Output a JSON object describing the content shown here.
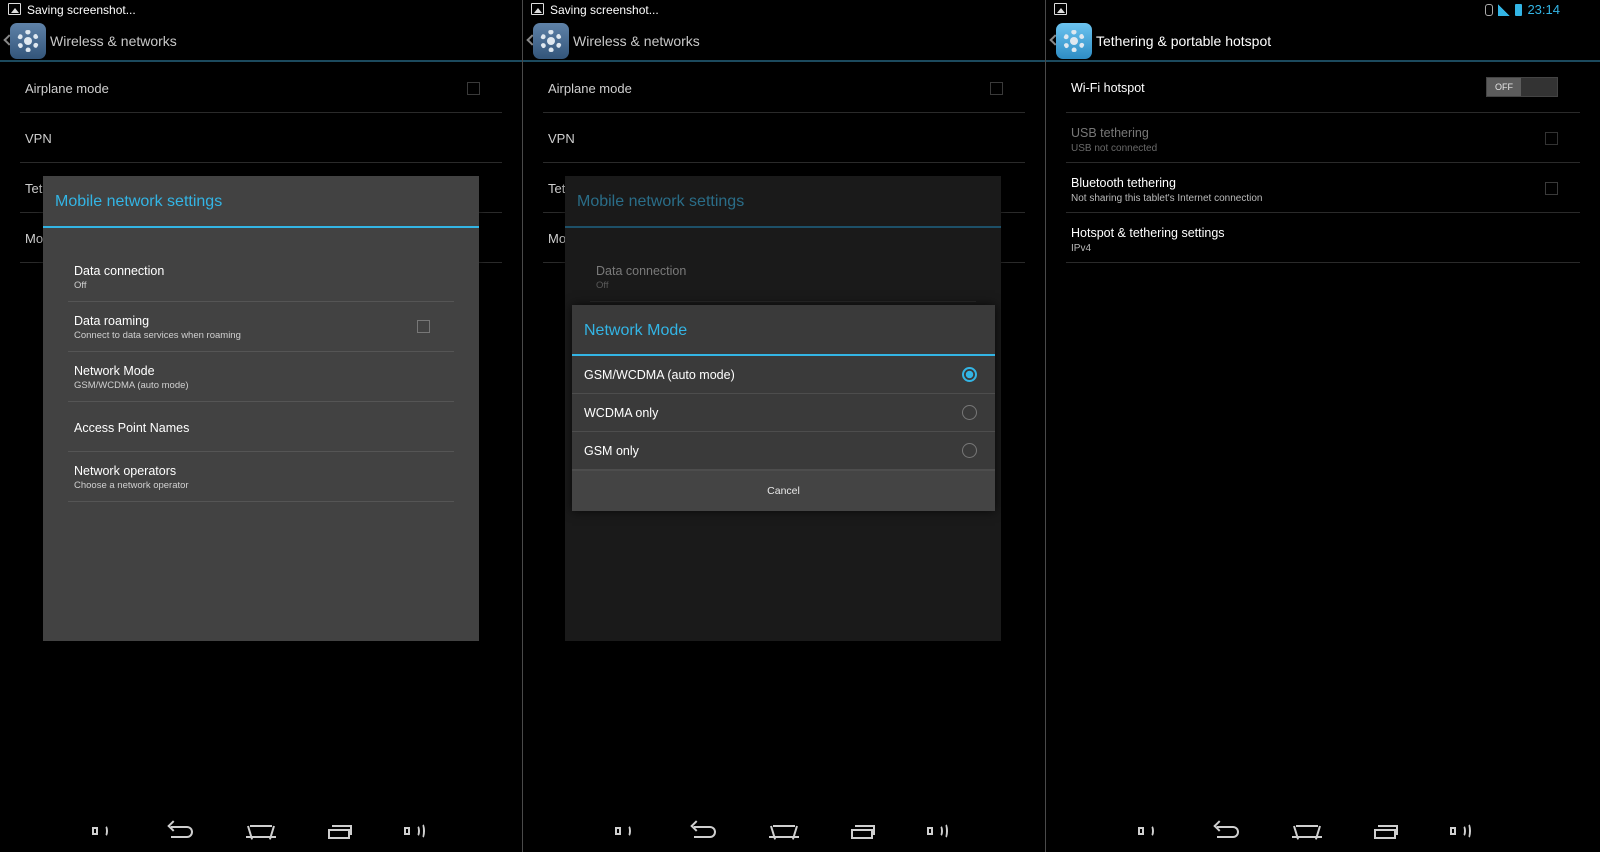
{
  "colors": {
    "accent": "#33b5e5",
    "background": "#000000",
    "dialog": "#424242"
  },
  "panels": [
    {
      "status_text": "Saving screenshot...",
      "title": "Wireless & networks",
      "list": [
        {
          "label": "Airplane mode"
        },
        {
          "label": "VPN"
        },
        {
          "label": "Tet"
        },
        {
          "label": "Mo"
        }
      ],
      "dialog": {
        "title": "Mobile network settings",
        "items": [
          {
            "label": "Data connection",
            "sub": "Off"
          },
          {
            "label": "Data roaming",
            "sub": "Connect to data services when roaming",
            "checkbox": false
          },
          {
            "label": "Network Mode",
            "sub": "GSM/WCDMA (auto mode)"
          },
          {
            "label": "Access Point Names"
          },
          {
            "label": "Network operators",
            "sub": "Choose a network operator"
          }
        ]
      }
    },
    {
      "status_text": "Saving screenshot...",
      "title": "Wireless & networks",
      "list": [
        {
          "label": "Airplane mode"
        },
        {
          "label": "VPN"
        },
        {
          "label": "Tet"
        },
        {
          "label": "Mo"
        }
      ],
      "dialog": {
        "title": "Mobile network settings",
        "items": [
          {
            "label": "Data connection",
            "sub": "Off"
          }
        ]
      },
      "network_mode": {
        "title": "Network Mode",
        "options": [
          {
            "label": "GSM/WCDMA (auto mode)",
            "selected": true
          },
          {
            "label": "WCDMA only",
            "selected": false
          },
          {
            "label": "GSM only",
            "selected": false
          }
        ],
        "cancel": "Cancel"
      }
    },
    {
      "status": {
        "time": "23:14",
        "icons": [
          "image-icon",
          "bluetooth-icon",
          "signal-icon",
          "battery-icon"
        ]
      },
      "title": "Tethering & portable hotspot",
      "list": [
        {
          "label": "Wi-Fi hotspot",
          "toggle": "OFF"
        },
        {
          "label": "USB tethering",
          "sub": "USB not connected",
          "checkbox": false,
          "disabled": true
        },
        {
          "label": "Bluetooth tethering",
          "sub": "Not sharing this tablet's Internet connection",
          "checkbox": false
        },
        {
          "label": "Hotspot & tethering settings",
          "sub": "IPv4"
        }
      ]
    }
  ],
  "navbar": [
    "volume-down-icon",
    "back-icon",
    "home-icon",
    "recent-apps-icon",
    "volume-up-icon"
  ]
}
